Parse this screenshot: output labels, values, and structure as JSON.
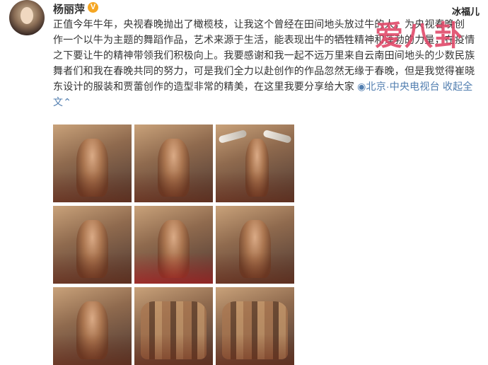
{
  "user": {
    "name": "杨丽萍",
    "verified_badge": "V"
  },
  "post": {
    "lines": [
      "正值今年牛年，央视春晚抛出了橄榄枝，让我这个曾经在田间地头放过牛的人，为央视春晚创",
      "作一个以牛为主题的舞蹈作品，艺术来源于生活，能表现出牛的牺牲精神和蓬勃的力量，在疫情",
      "之下要让牛的精神带领我们积极向上。我要感谢和我一起不远万里来自云南田间地头的少数民族",
      "舞者们和我在春晚共同的努力，可是我们全力以赴创作的作品忽然无缘于春晚，但是我觉得崔晓",
      "东设计的服装和贾蕾创作的造型非常的精美，在这里我要分享给大家 "
    ],
    "location": "北京·中央电视台",
    "collapse_label": "收起全",
    "collapse_tail": "文",
    "collapse_icon": "⌃"
  },
  "watermark": {
    "brand": "爱八卦",
    "author": "冰福儿"
  },
  "photos": [
    "dancer-1",
    "dancer-2",
    "dancer-horns",
    "dancer-4",
    "dancer-red-paint",
    "dancer-6",
    "dancer-7",
    "dancer-8",
    "dancer-group"
  ]
}
